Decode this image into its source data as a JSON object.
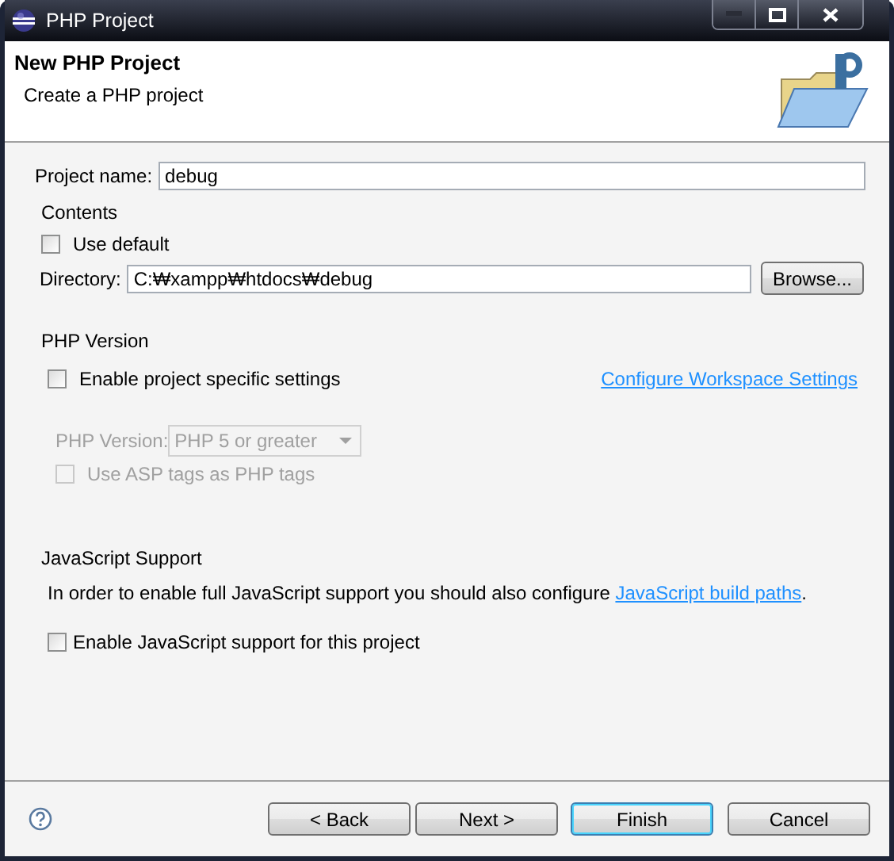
{
  "window": {
    "title": "PHP Project"
  },
  "header": {
    "title": "New PHP Project",
    "subtitle": "Create a PHP project"
  },
  "project_name": {
    "label": "Project name:",
    "value": "debug"
  },
  "contents": {
    "title": "Contents",
    "use_default": {
      "label": "Use default",
      "checked": false
    },
    "directory": {
      "label": "Directory:",
      "value": "C:₩xampp₩htdocs₩debug"
    },
    "browse_button": "Browse..."
  },
  "php_version": {
    "title": "PHP Version",
    "enable_specific": {
      "label": "Enable project specific settings",
      "checked": false
    },
    "configure_link": "Configure Workspace Settings",
    "version": {
      "label": "PHP Version:",
      "value": "PHP 5 or greater",
      "disabled": true
    },
    "asp_tags": {
      "label": "Use ASP tags as PHP tags",
      "checked": false,
      "disabled": true
    }
  },
  "javascript": {
    "title": "JavaScript Support",
    "note": "In order to enable full JavaScript support you should also configure ",
    "link": "JavaScript build paths",
    "note_end": ".",
    "enable": {
      "label": "Enable JavaScript support for this project",
      "checked": false
    }
  },
  "buttons": [
    {
      "label": "< Back",
      "default": false
    },
    {
      "label": "Next >",
      "default": false
    },
    {
      "label": "Finish",
      "default": true
    },
    {
      "label": "Cancel",
      "default": false
    }
  ]
}
